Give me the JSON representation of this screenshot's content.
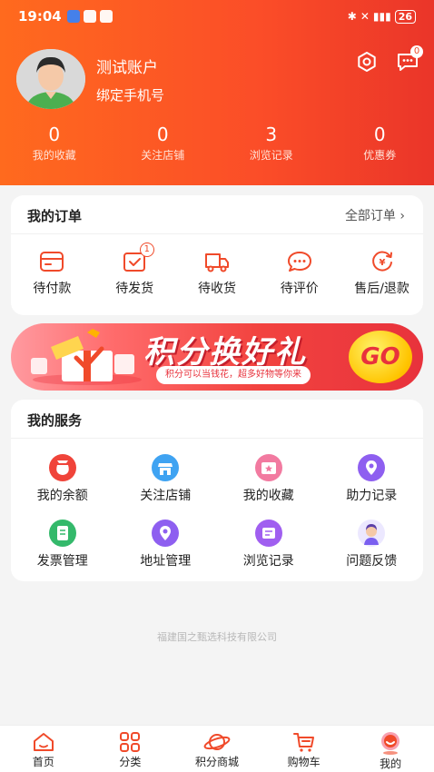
{
  "status_bar": {
    "time": "19:04",
    "battery": "26"
  },
  "profile": {
    "username": "测试账户",
    "bind_phone": "绑定手机号",
    "message_badge": "0"
  },
  "stats": [
    {
      "value": "0",
      "label": "我的收藏"
    },
    {
      "value": "0",
      "label": "关注店铺"
    },
    {
      "value": "3",
      "label": "浏览记录"
    },
    {
      "value": "0",
      "label": "优惠券"
    }
  ],
  "orders": {
    "title": "我的订单",
    "all_label": "全部订单 ›",
    "items": [
      {
        "label": "待付款",
        "icon": "wallet-icon"
      },
      {
        "label": "待发货",
        "icon": "package-icon",
        "badge": "1"
      },
      {
        "label": "待收货",
        "icon": "truck-icon"
      },
      {
        "label": "待评价",
        "icon": "comment-icon"
      },
      {
        "label": "售后/退款",
        "icon": "refund-icon"
      }
    ]
  },
  "banner": {
    "title": "积分换好礼",
    "subtitle": "积分可以当钱花，超多好物等你来",
    "go": "GO"
  },
  "services": {
    "title": "我的服务",
    "items": [
      {
        "label": "我的余额",
        "icon": "money-bag-icon",
        "color": "#f0443a"
      },
      {
        "label": "关注店铺",
        "icon": "store-icon",
        "color": "#3fa3f2"
      },
      {
        "label": "我的收藏",
        "icon": "star-folder-icon",
        "color": "#f27aa0"
      },
      {
        "label": "助力记录",
        "icon": "location-pin-icon",
        "color": "#8e5ff0"
      },
      {
        "label": "发票管理",
        "icon": "invoice-icon",
        "color": "#34b96b"
      },
      {
        "label": "地址管理",
        "icon": "map-pin-icon",
        "color": "#8e5ff0"
      },
      {
        "label": "浏览记录",
        "icon": "history-icon",
        "color": "#a05ff0"
      },
      {
        "label": "问题反馈",
        "icon": "support-agent-icon",
        "color": "#7a5ff0"
      }
    ]
  },
  "company": "福建国之甄选科技有限公司",
  "tabbar": [
    {
      "label": "首页",
      "icon": "home-icon"
    },
    {
      "label": "分类",
      "icon": "category-icon"
    },
    {
      "label": "积分商城",
      "icon": "planet-icon"
    },
    {
      "label": "购物车",
      "icon": "cart-icon"
    },
    {
      "label": "我的",
      "icon": "profile-icon",
      "active": true
    }
  ],
  "colors": {
    "accent": "#f04a2a",
    "header_start": "#ff6a1e",
    "header_end": "#ea3529"
  }
}
